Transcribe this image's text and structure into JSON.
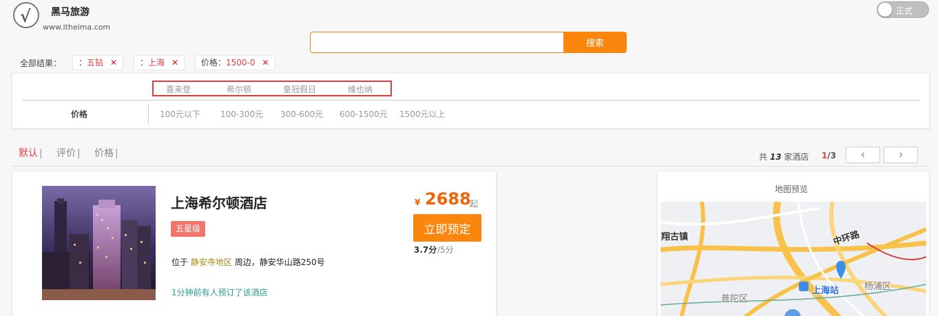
{
  "header": {
    "brand_name": "黑马旅游",
    "brand_url": "www.itheima.com",
    "env_toggle_label": "正式"
  },
  "search": {
    "value": "",
    "placeholder": "",
    "button_label": "搜索"
  },
  "crumbs": {
    "label": "全部结果：",
    "chips": [
      {
        "prefix": "：",
        "value": "五钻",
        "remove": "✕"
      },
      {
        "prefix": "：",
        "value": "上海",
        "remove": "✕"
      },
      {
        "prefix": "价格：",
        "value": "1500-0",
        "remove": "✕"
      }
    ]
  },
  "filters": {
    "brands": [
      "喜来登",
      "希尔顿",
      "皇冠假日",
      "维也纳"
    ],
    "price_label": "价格",
    "prices": [
      "100元以下",
      "100-300元",
      "300-600元",
      "600-1500元",
      "1500元以上"
    ]
  },
  "sort": {
    "items": [
      "默认",
      "评价",
      "价格"
    ],
    "separator": "|",
    "active_index": 0
  },
  "results": {
    "prefix": "共",
    "count": "13",
    "suffix": "家酒店",
    "page_current": "1",
    "page_total": "/3",
    "prev_icon": "‹",
    "next_icon": "›"
  },
  "hotel": {
    "name": "上海希尔顿酒店",
    "star": "五星级",
    "addr_prefix": "位于",
    "district": "静安寺地区",
    "addr_suffix": "周边，静安华山路250号",
    "recent_booking": "1分钟前有人预订了该酒店",
    "currency": "¥",
    "price": "2688",
    "price_suffix": "起",
    "book_label": "立即预定",
    "score": "3.7分",
    "score_max": "/5分"
  },
  "map": {
    "title": "地图预览",
    "labels": [
      "翔古镇",
      "中环路",
      "上海站",
      "杨浦区",
      "普陀区"
    ]
  },
  "colors": {
    "accent_orange": "#fa860d",
    "price_orange": "#f0640a",
    "highlight_red": "#e04040",
    "star_badge": "#f4756c",
    "recent_green": "#2a9d8f"
  }
}
